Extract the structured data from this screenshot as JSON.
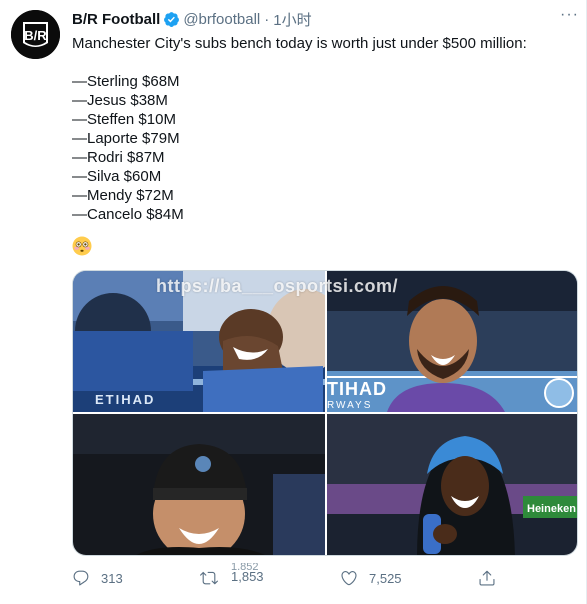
{
  "tweet": {
    "display_name": "B/R Football",
    "handle": "@brfootball",
    "separator": "·",
    "time": "1小时",
    "avatar_text": "B/R",
    "lines": [
      "Manchester City's subs bench today is worth just under $500 million:",
      "",
      "—Sterling $68M",
      "—Jesus $38M",
      "—Steffen $10M",
      "—Laporte $79M",
      "—Rodri $87M",
      "—Silva $60M",
      "—Mendy $72M",
      "—Cancelo $84M"
    ],
    "emoji": "flushed-face-emoji"
  },
  "media": {
    "watermark": "https://ba___osportsi.com/",
    "photos": [
      {
        "name": "sterling-laughing-photo",
        "board_text": "ETIHAD"
      },
      {
        "name": "bernardo-silva-photo",
        "board_text": "TIHAD / RWAYS"
      },
      {
        "name": "laporte-beanie-photo",
        "board_text": ""
      },
      {
        "name": "mendy-hooded-photo",
        "board_text": "Heineken"
      }
    ]
  },
  "actions": {
    "reply_count": "313",
    "retweet_count_top": "1,852",
    "retweet_count": "1,853",
    "like_count": "7,525"
  },
  "icons": [
    "more-icon",
    "verified-icon",
    "reply-icon",
    "retweet-icon",
    "like-icon",
    "share-icon"
  ],
  "colors": {
    "verified": "#1da1f2",
    "secondary_text": "#5b7083"
  }
}
